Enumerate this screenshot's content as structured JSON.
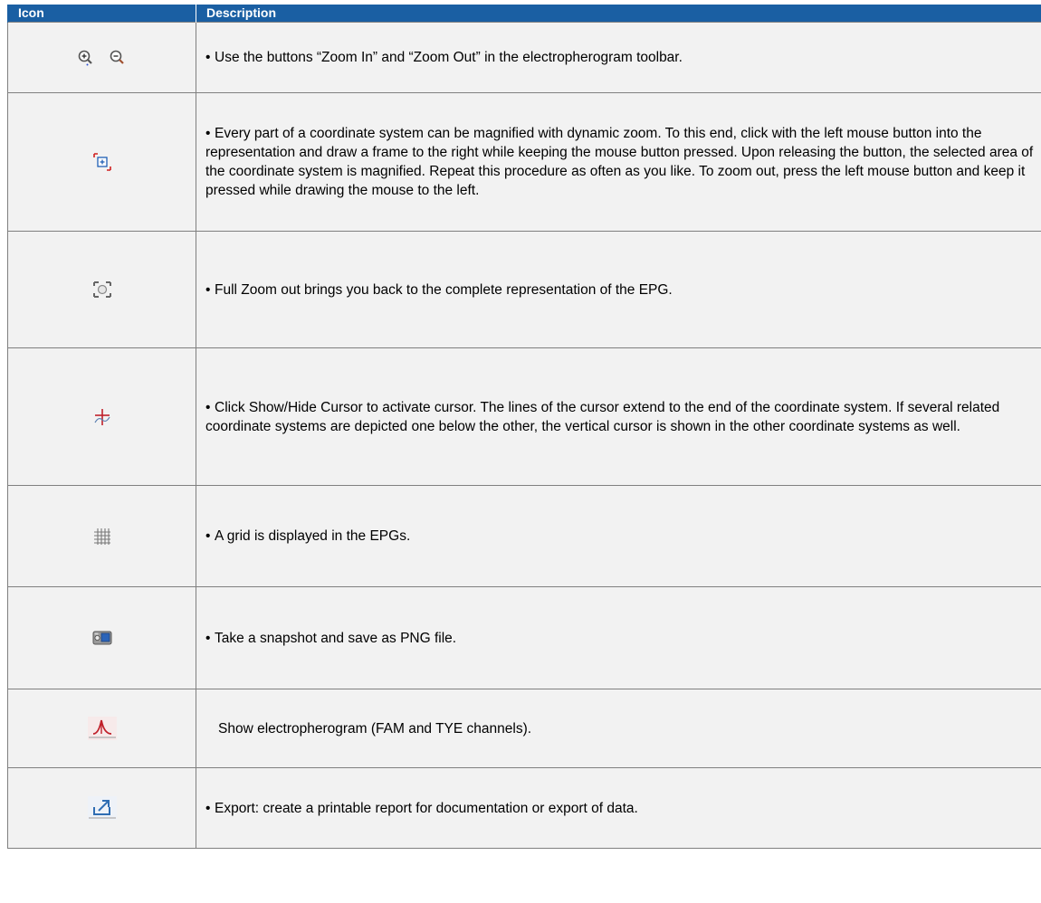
{
  "header": {
    "icon_label": "Icon",
    "description_label": "Description"
  },
  "rows": [
    {
      "icons": [
        "zoom-in-icon",
        "zoom-out-icon"
      ],
      "bullet": true,
      "text": "Use the buttons “Zoom In” and “Zoom Out” in the electropherogram toolbar."
    },
    {
      "icons": [
        "dynamic-zoom-icon"
      ],
      "bullet": true,
      "text": "Every part of a coordinate system can be magnified with dynamic zoom. To this end, click with the left mouse button into the representation and draw a frame to the right while keeping the mouse button pressed. Upon releasing the button, the selected area of the coordinate system is magnified. Repeat this procedure as often as you like. To zoom out, press the left mouse button and keep it pressed while drawing the mouse to the left."
    },
    {
      "icons": [
        "full-zoom-out-icon"
      ],
      "bullet": true,
      "text": "Full Zoom out brings you back to the complete representation of the EPG."
    },
    {
      "icons": [
        "cursor-icon"
      ],
      "bullet": true,
      "text": "Click Show/Hide Cursor to activate cursor. The lines of the cursor extend to the end of the coordinate system. If several related coordinate systems are depicted one below the other, the vertical cursor is shown in the other coordinate systems as well."
    },
    {
      "icons": [
        "grid-icon"
      ],
      "bullet": true,
      "text": "A grid is displayed in the EPGs."
    },
    {
      "icons": [
        "snapshot-camera-icon"
      ],
      "bullet": true,
      "text": "Take a snapshot and save as PNG file."
    },
    {
      "icons": [
        "electropherogram-icon"
      ],
      "bullet": false,
      "text": "Show electropherogram (FAM and TYE channels)."
    },
    {
      "icons": [
        "export-icon"
      ],
      "bullet": true,
      "text": "Export: create a printable report for documentation or export of data."
    }
  ],
  "colors": {
    "header_background": "#1a5fa3",
    "row_background": "#f2f2f2",
    "cursor_red": "#c0202a",
    "export_blue": "#2f6db3"
  }
}
